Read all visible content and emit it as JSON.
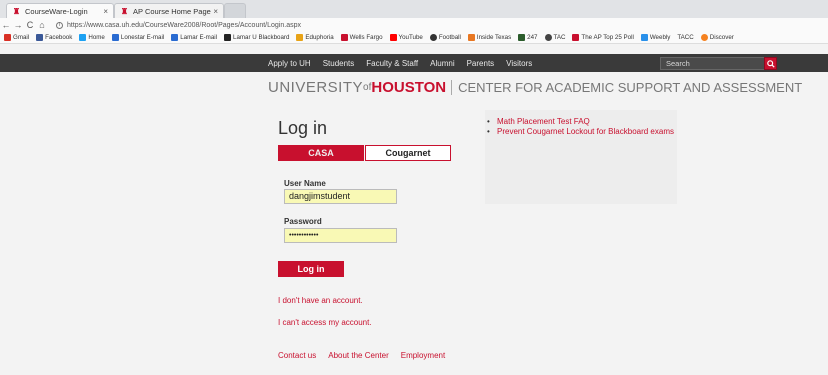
{
  "browser": {
    "tabs": [
      {
        "title": "CourseWare-Login",
        "close": "×"
      },
      {
        "title": "AP Course Home Page",
        "close": "×"
      }
    ],
    "url": "https://www.casa.uh.edu/CourseWare2008/Root/Pages/Account/Login.aspx",
    "nav": {
      "back": "←",
      "forward": "→",
      "reload": "C",
      "home": "⌂"
    },
    "bookmarks": [
      "Gmail",
      "Facebook",
      "Home",
      "Lonestar E-mail",
      "Lamar E-mail",
      "Lamar U Blackboard",
      "Eduphoria",
      "Wells Fargo",
      "YouTube",
      "Football",
      "Inside Texas",
      "247",
      "TAC",
      "The AP Top 25 Poll",
      "Weebly",
      "TACC",
      "Discover"
    ]
  },
  "site_nav": {
    "links": [
      "Apply to UH",
      "Students",
      "Faculty & Staff",
      "Alumni",
      "Parents",
      "Visitors"
    ],
    "search_placeholder": "Search"
  },
  "brand": {
    "university": "UNIVERSITY",
    "of": "of",
    "houston": "HOUSTON",
    "center": "CENTER FOR ACADEMIC SUPPORT AND ASSESSMENT"
  },
  "login": {
    "title": "Log in",
    "tab_casa": "CASA",
    "tab_cougarnet": "Cougarnet",
    "username_label": "User Name",
    "username_value": "dangjimstudent",
    "password_label": "Password",
    "password_value": "••••••••••••",
    "submit_label": "Log in",
    "no_account_link": "I don't have an account.",
    "cant_access_link": "I can't access my account."
  },
  "footer": {
    "links": [
      "Contact us",
      "About the Center",
      "Employment"
    ]
  },
  "panel": {
    "links": [
      "Math Placement Test FAQ",
      "Prevent Cougarnet Lockout for Blackboard exams"
    ]
  },
  "colors": {
    "accent": "#c8102e",
    "nav_bg": "#3a3a3a",
    "input_bg": "#f9f9b5"
  }
}
